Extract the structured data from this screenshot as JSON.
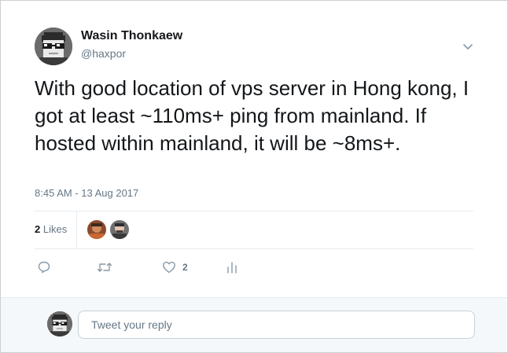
{
  "author": {
    "display_name": "Wasin Thonkaew",
    "handle": "@haxpor",
    "avatar_icon": "pixel-glasses-avatar-icon"
  },
  "tweet": {
    "text": "With good location of vps server in Hong kong, I got at least ~110ms+ ping from mainland. If hosted within mainland, it will be ~8ms+.",
    "timestamp": "8:45 AM - 13 Aug 2017"
  },
  "stats": {
    "likes_count": "2",
    "likes_label": "Likes"
  },
  "actions": {
    "reply_icon": "reply-icon",
    "retweet_icon": "retweet-icon",
    "like_icon": "heart-icon",
    "like_count": "2",
    "analytics_icon": "analytics-icon"
  },
  "reply": {
    "placeholder": "Tweet your reply"
  },
  "colors": {
    "text_primary": "#14171a",
    "text_secondary": "#657786",
    "divider": "#e6ecf0",
    "reply_background": "#f5f8fa"
  }
}
